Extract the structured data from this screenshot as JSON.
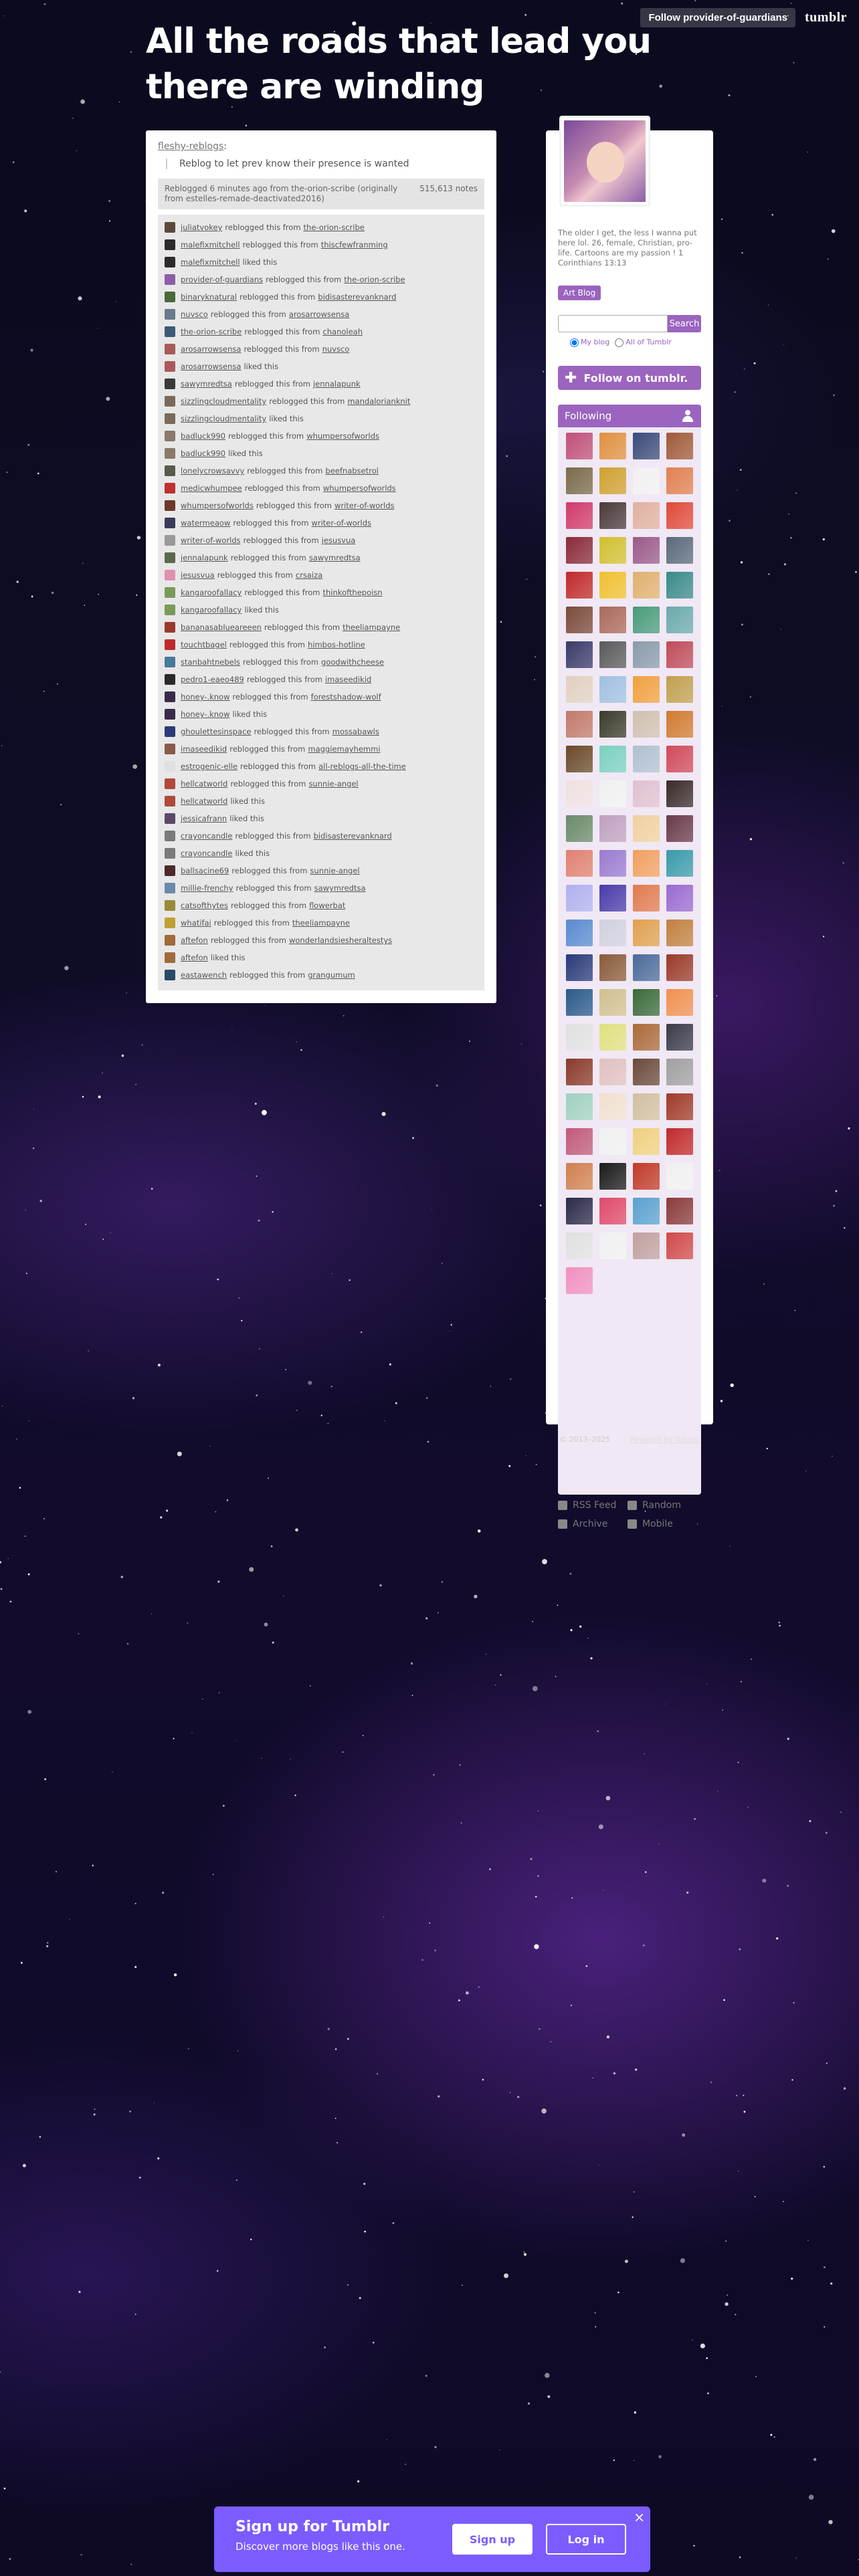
{
  "topbar": {
    "follow_label": "Follow provider-of-guardians",
    "logo": "tumblr"
  },
  "blog": {
    "title": "All the roads that lead you there are winding"
  },
  "post": {
    "author": "fleshy-reblogs",
    "author_suffix": ":",
    "quote": "Reblog to let prev know their presence is wanted",
    "meta_text": "Reblogged 6 minutes ago from the-orion-scribe (originally from estelles-remade-deactivated2016)",
    "notes_count": "515,613 notes",
    "notes": [
      {
        "user": "juliatvokey",
        "action": "reblogged this from",
        "from": "the-orion-scribe",
        "color": "#5a4a3a"
      },
      {
        "user": "malefixmitchell",
        "action": "reblogged this from",
        "from": "thiscfewfranming",
        "color": "#2e2a2a"
      },
      {
        "user": "malefixmitchell",
        "action": "liked this",
        "from": "",
        "color": "#2e2a2a"
      },
      {
        "user": "provider-of-guardians",
        "action": "reblogged this from",
        "from": "the-orion-scribe",
        "color": "#8a5ea8"
      },
      {
        "user": "binaryknatural",
        "action": "reblogged this from",
        "from": "bidisasterevanknard",
        "color": "#4a6a3a"
      },
      {
        "user": "nuvsco",
        "action": "reblogged this from",
        "from": "arosarrowsensa",
        "color": "#6a7a8a"
      },
      {
        "user": "the-orion-scribe",
        "action": "reblogged this from",
        "from": "chanoleah",
        "color": "#3a5a7a"
      },
      {
        "user": "arosarrowsensa",
        "action": "reblogged this from",
        "from": "nuvsco",
        "color": "#aa5a5a"
      },
      {
        "user": "arosarrowsensa",
        "action": "liked this",
        "from": "",
        "color": "#aa5a5a"
      },
      {
        "user": "sawymredtsa",
        "action": "reblogged this from",
        "from": "jennalapunk",
        "color": "#3a3a3a"
      },
      {
        "user": "sizzlingcloudmentality",
        "action": "reblogged this from",
        "from": "mandalorianknit",
        "color": "#7a6a5a"
      },
      {
        "user": "sizzlingcloudmentality",
        "action": "liked this",
        "from": "",
        "color": "#7a6a5a"
      },
      {
        "user": "badluck990",
        "action": "reblogged this from",
        "from": "whumpersofworlds",
        "color": "#8a7a6a"
      },
      {
        "user": "badluck990",
        "action": "liked this",
        "from": "",
        "color": "#8a7a6a"
      },
      {
        "user": "lonelycrowsavvy",
        "action": "reblogged this from",
        "from": "beefnabsetrol",
        "color": "#5a5a4a"
      },
      {
        "user": "medicwhumpee",
        "action": "reblogged this from",
        "from": "whumpersofworlds",
        "color": "#c03030"
      },
      {
        "user": "whumpersofworlds",
        "action": "reblogged this from",
        "from": "writer-of-worlds",
        "color": "#6a3a2a"
      },
      {
        "user": "watermeaow",
        "action": "reblogged this from",
        "from": "writer-of-worlds",
        "color": "#3a3a5a"
      },
      {
        "user": "writer-of-worlds",
        "action": "reblogged this from",
        "from": "jesusvua",
        "color": "#9a9a9a"
      },
      {
        "user": "jennalapunk",
        "action": "reblogged this from",
        "from": "sawymredtsa",
        "color": "#5a6a4a"
      },
      {
        "user": "jesusvua",
        "action": "reblogged this from",
        "from": "crsaiza",
        "color": "#e090b0"
      },
      {
        "user": "kangaroofallacy",
        "action": "reblogged this from",
        "from": "thinkofthepoisn",
        "color": "#7a9a5a"
      },
      {
        "user": "kangaroofallacy",
        "action": "liked this",
        "from": "",
        "color": "#7a9a5a"
      },
      {
        "user": "bananasablueareeen",
        "action": "reblogged this from",
        "from": "theeliampayne",
        "color": "#9a3a2a"
      },
      {
        "user": "touchtbagel",
        "action": "reblogged this from",
        "from": "himbos-hotline",
        "color": "#c02a2a"
      },
      {
        "user": "stanbahtnebels",
        "action": "reblogged this from",
        "from": "goodwithcheese",
        "color": "#4a7a9a"
      },
      {
        "user": "pedro1-eaeo489",
        "action": "reblogged this from",
        "from": "imaseedikid",
        "color": "#2a2a2a"
      },
      {
        "user": "honey-.know",
        "action": "reblogged this from",
        "from": "forestshadow-wolf",
        "color": "#3a2a4a"
      },
      {
        "user": "honey-.know",
        "action": "liked this",
        "from": "",
        "color": "#3a2a4a"
      },
      {
        "user": "ghoulettesinspace",
        "action": "reblogged this from",
        "from": "mossabawls",
        "color": "#2a3a7a"
      },
      {
        "user": "imaseedikid",
        "action": "reblogged this from",
        "from": "maggiemayhemmi",
        "color": "#8a5a4a"
      },
      {
        "user": "estrogenic-elle",
        "action": "reblogged this from",
        "from": "all-reblogs-all-the-time",
        "color": "#e0e0e0"
      },
      {
        "user": "hellcatworld",
        "action": "reblogged this from",
        "from": "sunnie-angel",
        "color": "#b04a3a"
      },
      {
        "user": "hellcatworld",
        "action": "liked this",
        "from": "",
        "color": "#b04a3a"
      },
      {
        "user": "jessicafrann",
        "action": "liked this",
        "from": "",
        "color": "#5a4a6a"
      },
      {
        "user": "crayoncandle",
        "action": "reblogged this from",
        "from": "bidisasterevanknard",
        "color": "#7a7a7a"
      },
      {
        "user": "crayoncandle",
        "action": "liked this",
        "from": "",
        "color": "#7a7a7a"
      },
      {
        "user": "ballsacine69",
        "action": "reblogged this from",
        "from": "sunnie-angel",
        "color": "#4a2a2a"
      },
      {
        "user": "millie-frenchy",
        "action": "reblogged this from",
        "from": "sawymredtsa",
        "color": "#6a8aaa"
      },
      {
        "user": "catsofthytes",
        "action": "reblogged this from",
        "from": "flowerbat",
        "color": "#9a8a3a"
      },
      {
        "user": "whatifai",
        "action": "reblogged this from",
        "from": "theeliampayne",
        "color": "#c0a030"
      },
      {
        "user": "aftefon",
        "action": "reblogged this from",
        "from": "wonderlandsiesheraltestys",
        "color": "#a06a3a"
      },
      {
        "user": "aftefon",
        "action": "liked this",
        "from": "",
        "color": "#a06a3a"
      },
      {
        "user": "eastawench",
        "action": "reblogged this from",
        "from": "grangumum",
        "color": "#2a4a6a"
      }
    ]
  },
  "sidebar": {
    "description": "The older I get, the less I wanna put here lol. 26, female, Christian, pro-life. Cartoons are my passion ! 1 Corinthians 13:13",
    "tag_button": "Art Blog",
    "search_placeholder": "",
    "search_button": "Search",
    "scope_my_blog": "My blog",
    "scope_all": "All of Tumblr",
    "follow_button": "Follow on tumblr.",
    "following_title": "Following",
    "following_tiles": [
      "#c0507a",
      "#e09040",
      "#3a4a7a",
      "#a05a3a",
      "#7a6a4a",
      "#d0a030",
      "#f0f0f0",
      "#e08050",
      "#d03a6a",
      "#4a3a3a",
      "#e0b0a0",
      "#e04a3a",
      "#8a2a3a",
      "#d0c030",
      "#9a5a8a",
      "#5a6a7a",
      "#c02a2a",
      "#f0c030",
      "#e0b070",
      "#3a8a8a",
      "#7a4a3a",
      "#aa6a5a",
      "#4a9a7a",
      "#6aaaaa",
      "#3a3a6a",
      "#5a5a5a",
      "#8a9aaa",
      "#c04a5a",
      "#e0d0c0",
      "#a0c0e0",
      "#f0a040",
      "#c0a050",
      "#c07a6a",
      "#3a3a2a",
      "#d0c0b0",
      "#d07a30",
      "#6a4a2a",
      "#7ad0c0",
      "#b0c0d0",
      "#d04a5a",
      "#f0e0e0",
      "#f0f0f0",
      "#e0c0d0",
      "#3a2a2a",
      "#6a8a6a",
      "#c0a0c0",
      "#f0d0a0",
      "#6a3a4a",
      "#e08070",
      "#9a7ad0",
      "#f0a060",
      "#3a9aaa",
      "#b0b0f0",
      "#4a3aaa",
      "#e07a50",
      "#9a6ad0",
      "#5a8ad0",
      "#d0d0e0",
      "#e0a050",
      "#c08040",
      "#2a3a7a",
      "#8a5a3a",
      "#4a6a9a",
      "#9a3a2a",
      "#2a5a8a",
      "#d0c090",
      "#3a6a3a",
      "#f09050",
      "#e0e0e0",
      "#e0e080",
      "#aa6a3a",
      "#3a3a4a",
      "#8a3a2a",
      "#e0c0c0",
      "#6a4a3a",
      "#a0a0a0",
      "#a0d0c0",
      "#f0e0d0",
      "#d0c0a0",
      "#a03a2a",
      "#c05a7a",
      "#f0f0f0",
      "#f0d080",
      "#c02a2a",
      "#d08050",
      "#1a1a1a",
      "#c03a2a",
      "#f0f0f0",
      "#2a2a4a",
      "#e04a6a",
      "#5aa0d0",
      "#8a3a3a",
      "#e0e0e0",
      "#f0f0f0",
      "#c0a0a0",
      "#d04a4a",
      "#f090c0"
    ],
    "links": [
      {
        "label": "RSS Feed",
        "icon": "rss-icon"
      },
      {
        "label": "Random",
        "icon": "shuffle-icon"
      },
      {
        "label": "Archive",
        "icon": "archive-icon"
      },
      {
        "label": "Mobile",
        "icon": "mobile-icon"
      }
    ],
    "footer_copyright": "© 2013–2025",
    "footer_powered": "Powered by Tumblr"
  },
  "signup": {
    "title": "Sign up for Tumblr",
    "subtitle": "Discover more blogs like this one.",
    "signup_label": "Sign up",
    "login_label": "Log in",
    "close": "×"
  }
}
